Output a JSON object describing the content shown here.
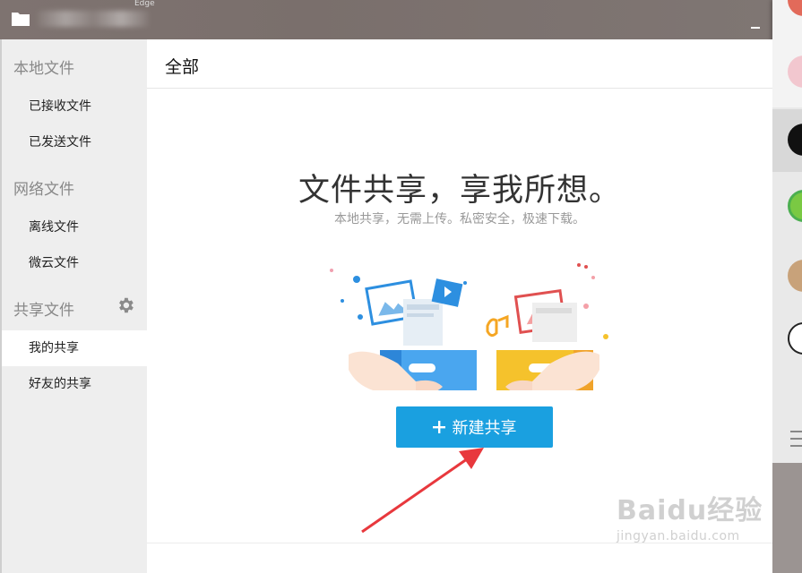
{
  "titlebar": {
    "faded_text": "Edge"
  },
  "sidebar": {
    "sections": [
      {
        "label": "本地文件",
        "items": [
          {
            "label": "已接收文件"
          },
          {
            "label": "已发送文件"
          }
        ]
      },
      {
        "label": "网络文件",
        "items": [
          {
            "label": "离线文件"
          },
          {
            "label": "微云文件"
          }
        ]
      },
      {
        "label": "共享文件",
        "items": [
          {
            "label": "我的共享"
          },
          {
            "label": "好友的共享"
          }
        ]
      }
    ],
    "active_item": "我的共享"
  },
  "main": {
    "title": "全部",
    "headline": "文件共享，享我所想。",
    "subline": "本地共享，无需上传。私密安全，极速下载。",
    "new_share_button": "新建共享"
  },
  "watermark": {
    "brand": "Baidu经验",
    "url": "jingyan.baidu.com"
  },
  "colors": {
    "titlebar": "#7e7370",
    "accent_button": "#1aa0e0",
    "sidebar_bg": "#eeeeee",
    "arrow": "#e8383d",
    "box_blue": "#3b8fdc",
    "box_yellow": "#f5c22c"
  },
  "icons": [
    "folder-icon",
    "gear-icon",
    "plus-icon",
    "menu-icon"
  ]
}
